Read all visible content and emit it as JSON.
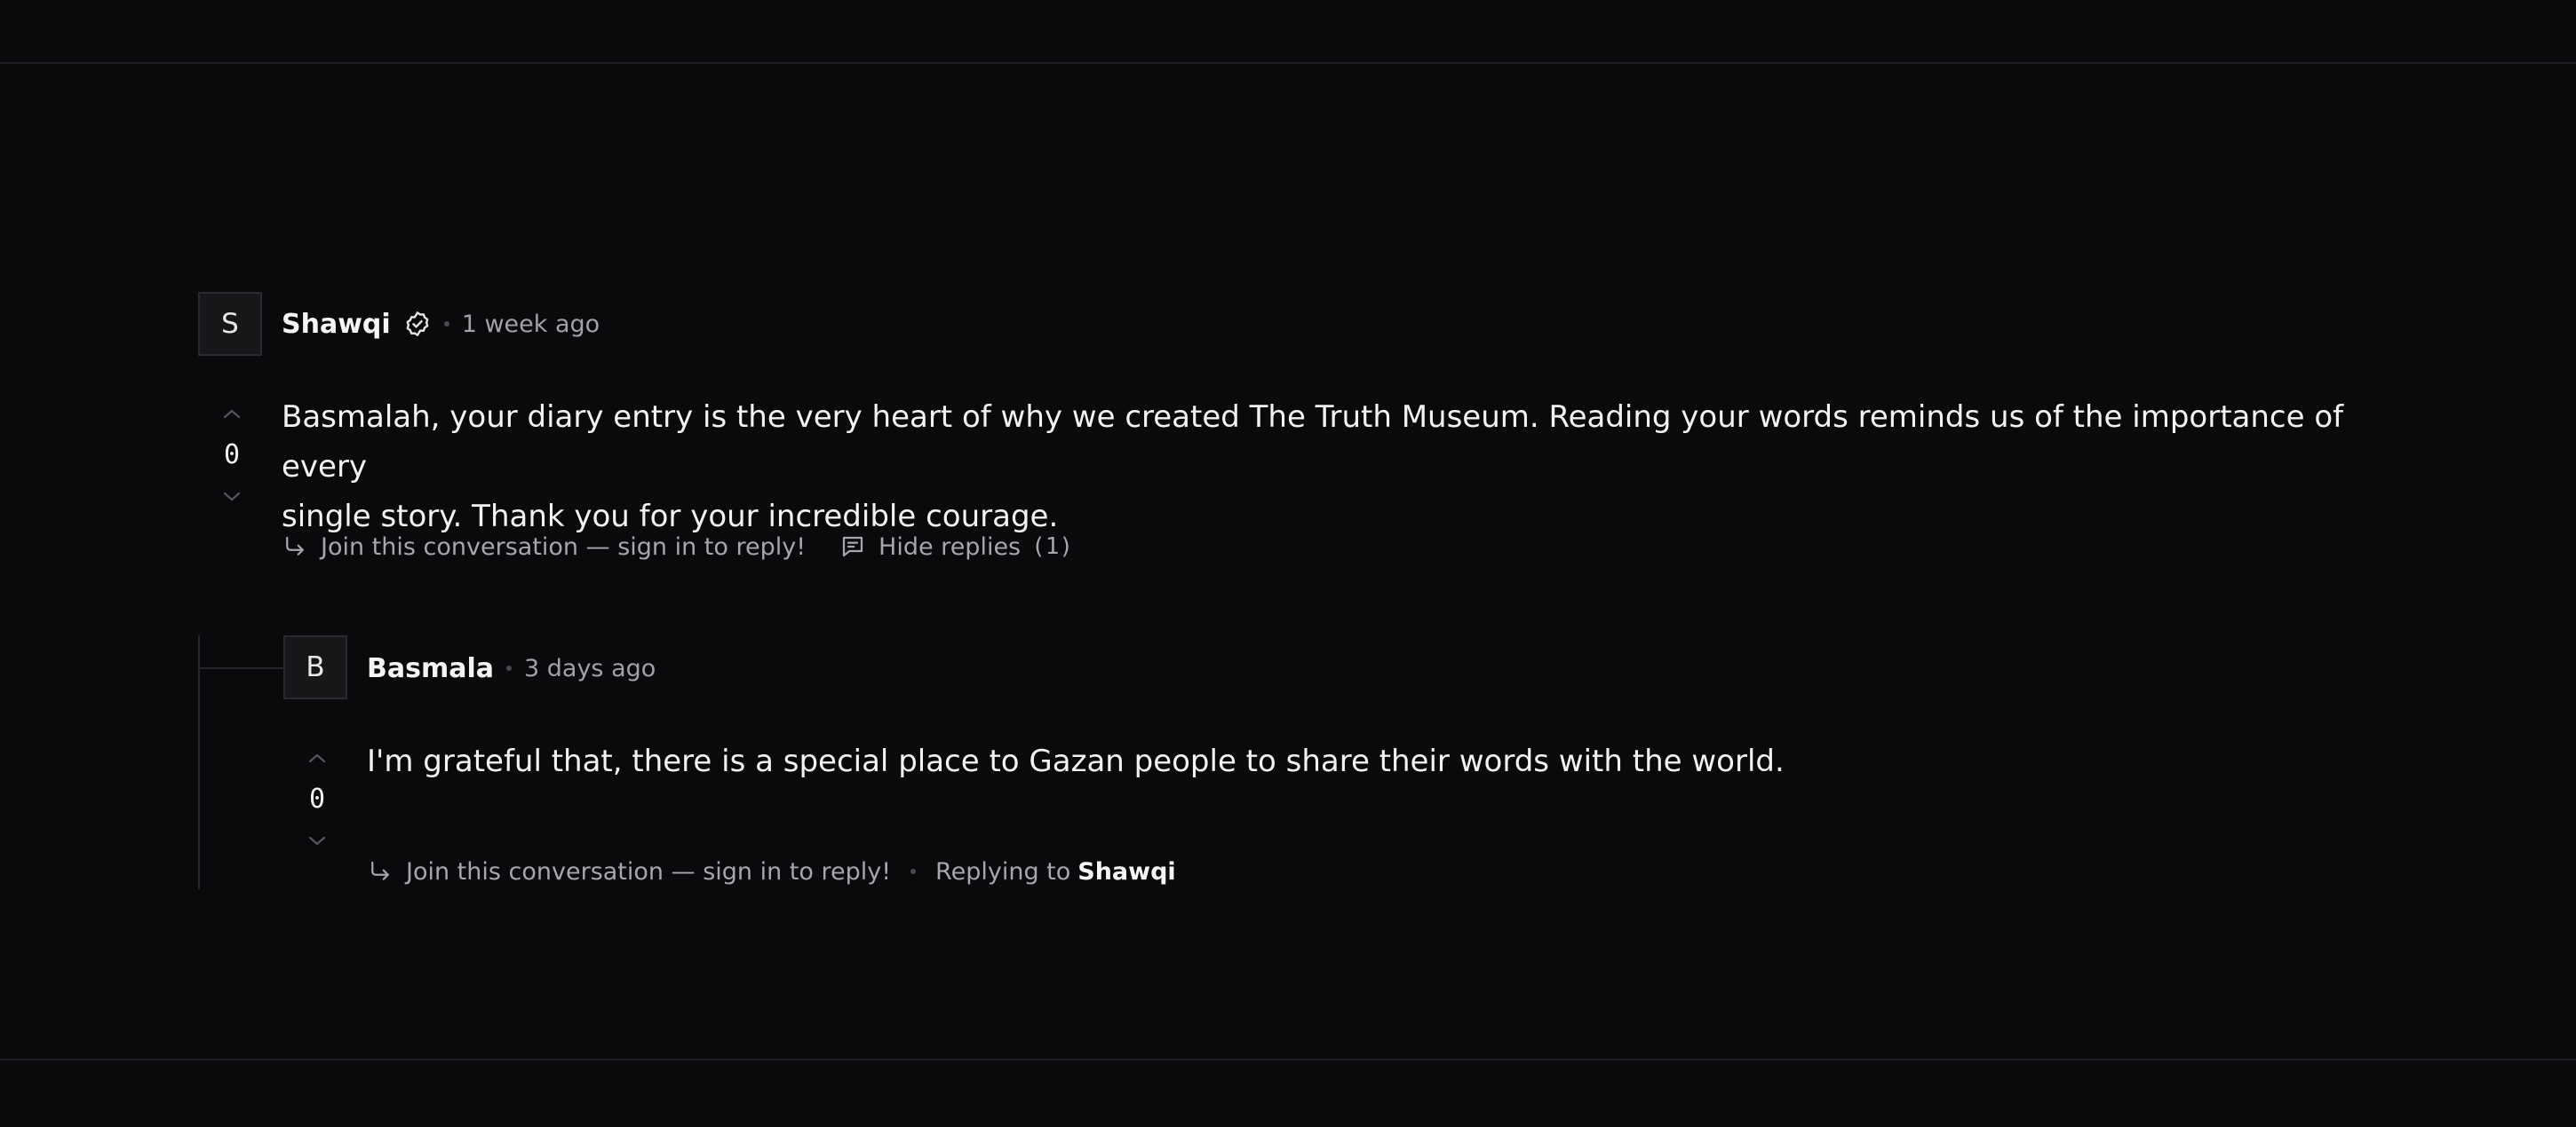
{
  "comments": [
    {
      "avatar_letter": "S",
      "author": "Shawqi",
      "verified": true,
      "time": "1 week ago",
      "body_line1": "Basmalah, your diary entry is the very heart of why we created The Truth Museum. Reading your words reminds us of the importance of every",
      "body_line2": "single story. Thank you for your incredible courage.",
      "votes": "0",
      "reply_prompt": "Join this conversation — sign in to reply!",
      "hide_replies_label": "Hide replies",
      "replies_count": "(1)"
    }
  ],
  "replies": [
    {
      "avatar_letter": "B",
      "author": "Basmala",
      "time": "3 days ago",
      "body": "I'm grateful that, there is a special place to Gazan people to share their words with the world.",
      "votes": "0",
      "reply_prompt": "Join this conversation — sign in to reply!",
      "replying_to_label": "Replying to",
      "replying_to_name": "Shawqi"
    }
  ],
  "icons": {
    "verified": "check-circle-icon",
    "upvote": "chevron-up-icon",
    "downvote": "chevron-down-icon",
    "reply": "reply-arrow-icon",
    "replies": "message-square-icon"
  },
  "colors": {
    "background": "#0a0a0c",
    "text_primary": "#f2f2f2",
    "text_muted": "#a6a6ab",
    "divider": "#1f1f23"
  }
}
